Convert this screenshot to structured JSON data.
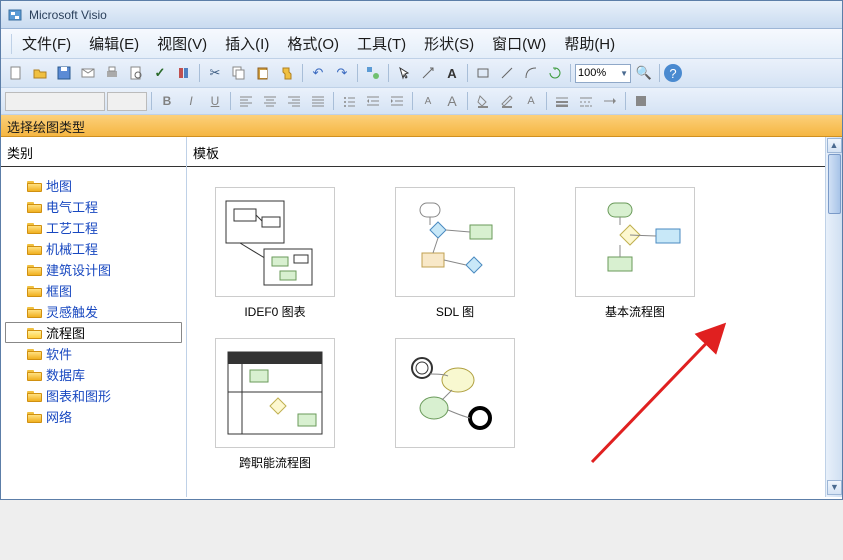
{
  "app": {
    "title": "Microsoft Visio"
  },
  "menu": {
    "file": "文件(F)",
    "edit": "编辑(E)",
    "view": "视图(V)",
    "insert": "插入(I)",
    "format": "格式(O)",
    "tools": "工具(T)",
    "shape": "形状(S)",
    "window": "窗口(W)",
    "help": "帮助(H)"
  },
  "toolbar": {
    "zoom": "100%"
  },
  "header": {
    "chooser": "选择绘图类型"
  },
  "panels": {
    "category": "类别",
    "templates": "模板"
  },
  "categories": [
    {
      "label": "地图",
      "selected": false
    },
    {
      "label": "电气工程",
      "selected": false
    },
    {
      "label": "工艺工程",
      "selected": false
    },
    {
      "label": "机械工程",
      "selected": false
    },
    {
      "label": "建筑设计图",
      "selected": false
    },
    {
      "label": "框图",
      "selected": false
    },
    {
      "label": "灵感触发",
      "selected": false
    },
    {
      "label": "流程图",
      "selected": true
    },
    {
      "label": "软件",
      "selected": false
    },
    {
      "label": "数据库",
      "selected": false
    },
    {
      "label": "图表和图形",
      "selected": false
    },
    {
      "label": "网络",
      "selected": false
    }
  ],
  "templates": [
    {
      "label": "IDEF0 图表"
    },
    {
      "label": "SDL 图"
    },
    {
      "label": "基本流程图"
    },
    {
      "label": "跨职能流程图"
    },
    {
      "label": ""
    }
  ]
}
